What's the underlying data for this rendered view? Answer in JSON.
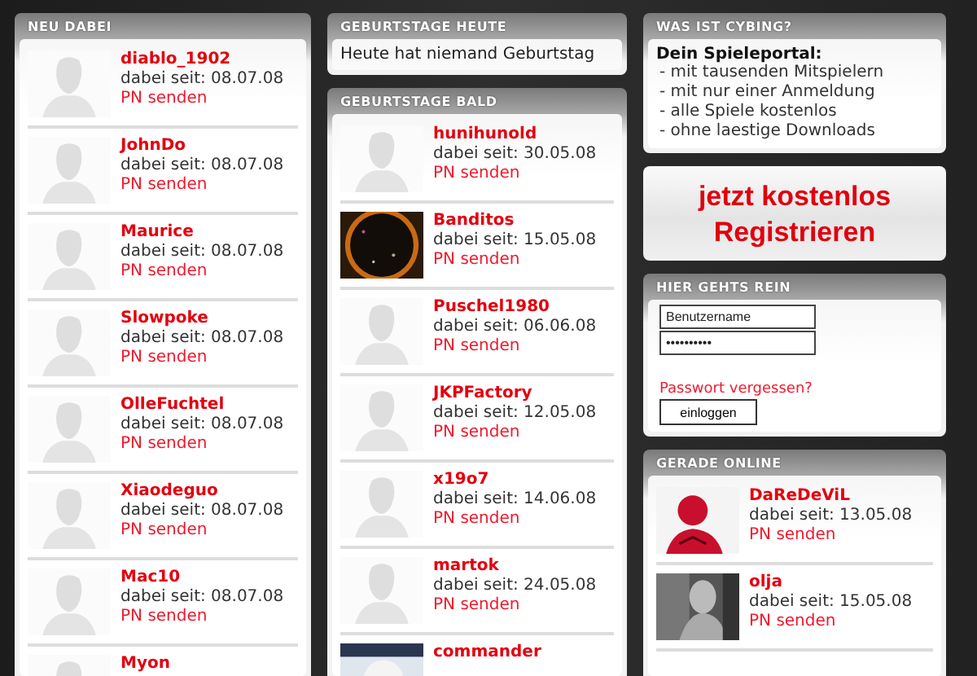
{
  "new_members": {
    "title": "NEU DABEI",
    "members": [
      {
        "name": "diablo_1902",
        "since": "dabei seit: 08.07.08",
        "action": "PN senden",
        "kind": "silhouette"
      },
      {
        "name": "JohnDo",
        "since": "dabei seit: 08.07.08",
        "action": "PN senden",
        "kind": "silhouette"
      },
      {
        "name": "Maurice",
        "since": "dabei seit: 08.07.08",
        "action": "PN senden",
        "kind": "silhouette"
      },
      {
        "name": "Slowpoke",
        "since": "dabei seit: 08.07.08",
        "action": "PN senden",
        "kind": "silhouette"
      },
      {
        "name": "OlleFuchtel",
        "since": "dabei seit: 08.07.08",
        "action": "PN senden",
        "kind": "silhouette"
      },
      {
        "name": "Xiaodeguo",
        "since": "dabei seit: 08.07.08",
        "action": "PN senden",
        "kind": "silhouette"
      },
      {
        "name": "Mac10",
        "since": "dabei seit: 08.07.08",
        "action": "PN senden",
        "kind": "silhouette"
      },
      {
        "name": "Myon",
        "kind": "silhouette"
      }
    ]
  },
  "birthdays_today": {
    "title": "GEBURTSTAGE HEUTE",
    "text": "Heute hat niemand Geburtstag"
  },
  "birthdays_soon": {
    "title": "GEBURTSTAGE BALD",
    "members": [
      {
        "name": "hunihunold",
        "since": "dabei seit: 30.05.08",
        "action": "PN senden",
        "kind": "silhouette"
      },
      {
        "name": "Banditos",
        "since": "dabei seit: 15.05.08",
        "action": "PN senden",
        "kind": "picture"
      },
      {
        "name": "Puschel1980",
        "since": "dabei seit: 06.06.08",
        "action": "PN senden",
        "kind": "silhouette"
      },
      {
        "name": "JKPFactory",
        "since": "dabei seit: 12.05.08",
        "action": "PN senden",
        "kind": "silhouette"
      },
      {
        "name": "x19o7",
        "since": "dabei seit: 14.06.08",
        "action": "PN senden",
        "kind": "silhouette"
      },
      {
        "name": "martok",
        "since": "dabei seit: 24.05.08",
        "action": "PN senden",
        "kind": "silhouette"
      },
      {
        "name": "commander",
        "kind": "picture"
      }
    ]
  },
  "about": {
    "title": "WAS IST CYBING?",
    "heading": "Dein Spieleportal:",
    "points": [
      "- mit tausenden Mitspielern",
      "- mit nur einer Anmeldung",
      "- alle Spiele kostenlos",
      "- ohne laestige Downloads"
    ]
  },
  "register": {
    "line_1": "jetzt kostenlos",
    "line_2": "Registrieren"
  },
  "login": {
    "title": "HIER GEHTS REIN",
    "username": {
      "placeholder": "Benutzername"
    },
    "password": {
      "value": "••••••••••"
    },
    "forgot": "Passwort vergessen?",
    "button": "einloggen"
  },
  "online": {
    "title": "GERADE ONLINE",
    "members": [
      {
        "name": "DaReDeViL",
        "since": "dabei seit: 13.05.08",
        "action": "PN senden",
        "kind": "picture"
      },
      {
        "name": "olja",
        "since": "dabei seit: 15.05.08",
        "action": "PN senden",
        "kind": "picture"
      }
    ]
  }
}
